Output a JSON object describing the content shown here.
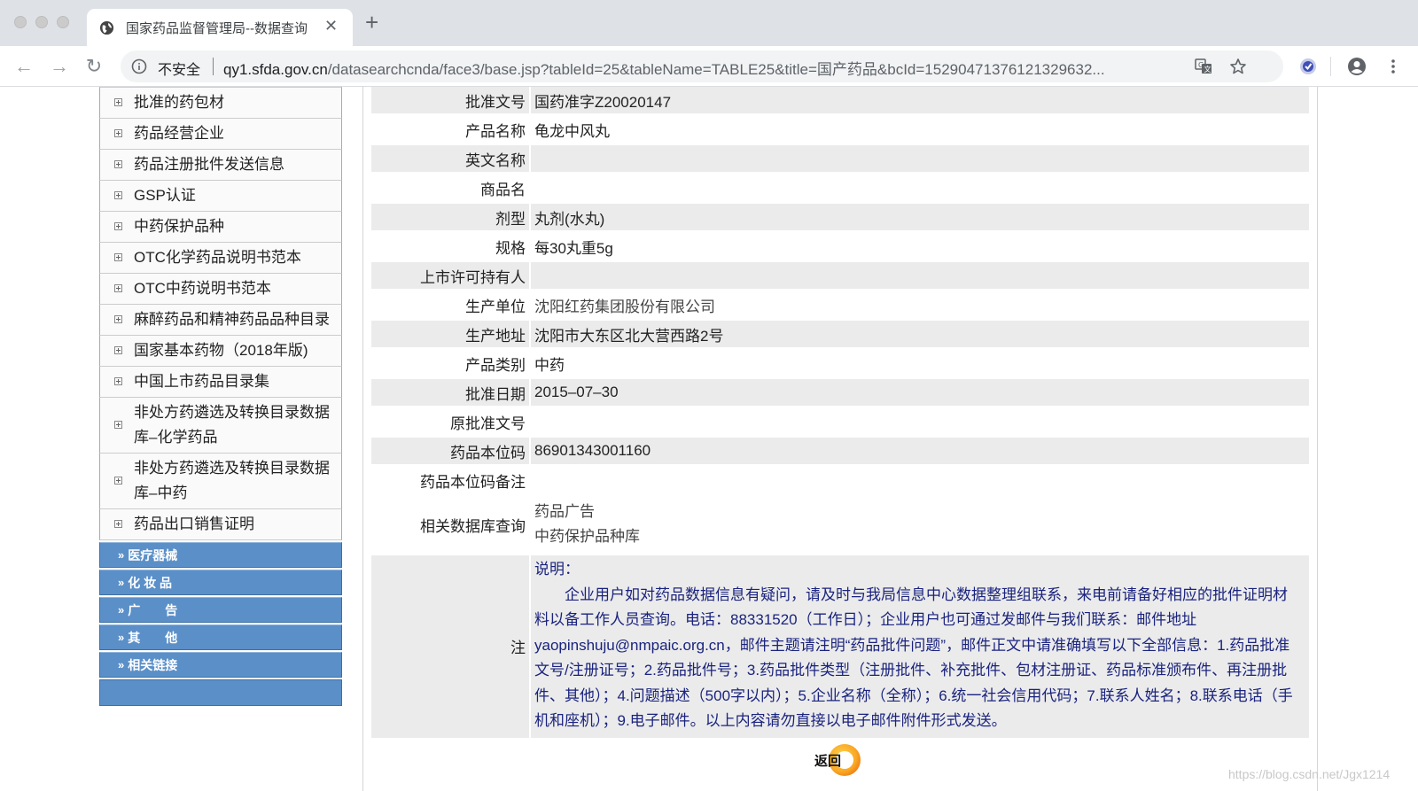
{
  "browser": {
    "tab_title": "国家药品监督管理局--数据查询",
    "security_label": "不安全",
    "url_host": "qy1.sfda.gov.cn",
    "url_path": "/datasearchcnda/face3/base.jsp?tableId=25&tableName=TABLE25&title=国产药品&bcId=15290471376121329632..."
  },
  "sidebar": {
    "items": [
      "批准的药包材",
      "药品经营企业",
      "药品注册批件发送信息",
      "GSP认证",
      "中药保护品种",
      "OTC化学药品说明书范本",
      "OTC中药说明书范本",
      "麻醉药品和精神药品品种目录",
      "国家基本药物（2018年版)",
      "中国上市药品目录集",
      "非处方药遴选及转换目录数据库–化学药品",
      "非处方药遴选及转换目录数据库–中药",
      "药品出口销售证明"
    ],
    "categories": [
      "医疗器械",
      "化 妆 品",
      "广　　告",
      "其　　他",
      "相关链接"
    ]
  },
  "details": {
    "approval_no_label": "批准文号",
    "approval_no": "国药准字Z20020147",
    "product_name_label": "产品名称",
    "product_name": "龟龙中风丸",
    "english_name_label": "英文名称",
    "english_name": "",
    "trade_name_label": "商品名",
    "trade_name": "",
    "dosage_form_label": "剂型",
    "dosage_form": "丸剂(水丸)",
    "spec_label": "规格",
    "spec": "每30丸重5g",
    "mah_label": "上市许可持有人",
    "mah": "",
    "manufacturer_label": "生产单位",
    "manufacturer": "沈阳红药集团股份有限公司",
    "address_label": "生产地址",
    "address": "沈阳市大东区北大营西路2号",
    "category_label": "产品类别",
    "category": "中药",
    "approval_date_label": "批准日期",
    "approval_date": "2015–07–30",
    "orig_approval_label": "原批准文号",
    "orig_approval": "",
    "code_label": "药品本位码",
    "code": "86901343001160",
    "code_note_label": "药品本位码备注",
    "code_note": "",
    "related_label": "相关数据库查询",
    "related_links": [
      "药品广告",
      "中药保护品种库"
    ],
    "note_label": "注",
    "note_title": "说明：",
    "note_body": "企业用户如对药品数据信息有疑问，请及时与我局信息中心数据整理组联系，来电前请备好相应的批件证明材料以备工作人员查询。电话：88331520（工作日）；企业用户也可通过发邮件与我们联系：邮件地址yaopinshuju@nmpaic.org.cn，邮件主题请注明“药品批件问题”，邮件正文中请准确填写以下全部信息：1.药品批准文号/注册证号；2.药品批件号；3.药品批件类型（注册批件、补充批件、包材注册证、药品标准颁布件、再注册批件、其他）；4.问题描述（500字以内）；5.企业名称（全称）；6.统一社会信用代码；7.联系人姓名；8.联系电话（手机和座机）；9.电子邮件。以上内容请勿直接以电子邮件附件形式发送。"
  },
  "return_label": "返回",
  "watermark": "https://blog.csdn.net/Jgx1214",
  "colors": {
    "category_bg": "#5b8fc8",
    "note_text": "#1a237e",
    "row_gray": "#ebebeb"
  }
}
